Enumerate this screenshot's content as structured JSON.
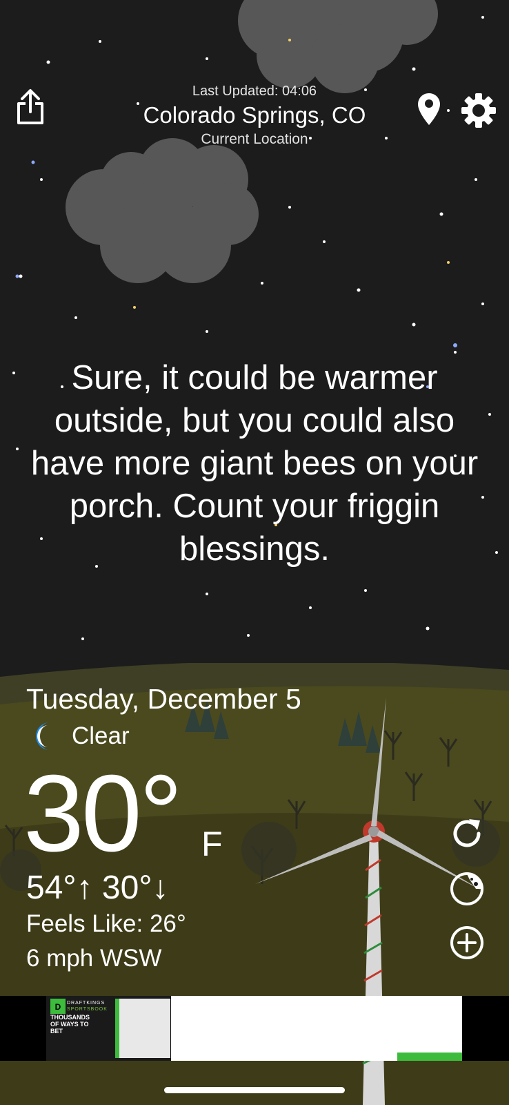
{
  "header": {
    "last_updated": "Last Updated: 04:06",
    "city": "Colorado Springs, CO",
    "location_label": "Current Location"
  },
  "icons": {
    "share": "share-icon",
    "location": "location-pin-icon",
    "settings": "gear-icon",
    "condition": "moon-icon",
    "refresh": "refresh-icon",
    "radar": "radar-icon",
    "add": "add-icon"
  },
  "quote": "Sure, it could be warmer outside, but you could also have more giant bees on your porch. Count your friggin blessings.",
  "weather": {
    "date": "Tuesday, December 5",
    "condition": "Clear",
    "temperature": "30°",
    "unit": "F",
    "high_low": "54°↑ 30°↓",
    "feels_like": "Feels Like: 26°",
    "wind": "6 mph WSW"
  },
  "ad": {
    "brand_line1": "DRAFTKINGS",
    "brand_line2": "SPORTSBOOK",
    "headline": "THOUSANDS OF WAYS TO BET"
  },
  "colors": {
    "sky": "#1c1c1c",
    "hill": "#4a4a1e",
    "text": "#ffffff",
    "moon": "#1e88e5",
    "ad_green": "#3dbb3d"
  }
}
